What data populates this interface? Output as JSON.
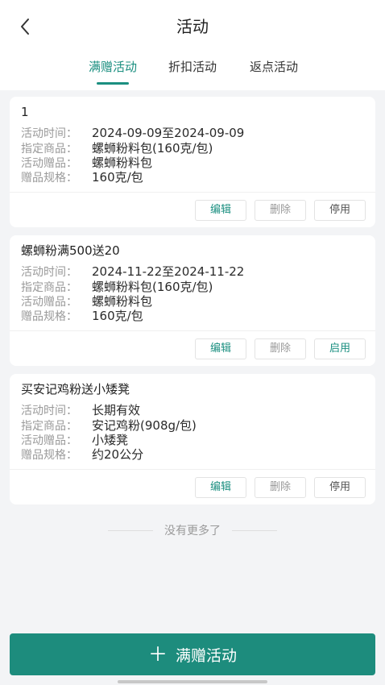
{
  "header": {
    "title": "活动",
    "back_icon": "chevron-left-icon"
  },
  "tabs": [
    {
      "label": "满赠活动",
      "active": true
    },
    {
      "label": "折扣活动",
      "active": false
    },
    {
      "label": "返点活动",
      "active": false
    }
  ],
  "labels": {
    "time": "活动时间：",
    "product": "指定商品：",
    "gift": "活动赠品：",
    "spec": "赠品规格："
  },
  "activities": [
    {
      "title": "1",
      "time": "2024-09-09至2024-09-09",
      "product": "螺蛳粉料包(160克/包)",
      "gift": "螺蛳粉料包",
      "spec": "160克/包",
      "edit": "编辑",
      "delete": "删除",
      "toggle": "停用"
    },
    {
      "title": "螺蛳粉满500送20",
      "time": "2024-11-22至2024-11-22",
      "product": "螺蛳粉料包(160克/包)",
      "gift": "螺蛳粉料包",
      "spec": "160克/包",
      "edit": "编辑",
      "delete": "删除",
      "toggle": "启用"
    },
    {
      "title": "买安记鸡粉送小矮凳",
      "time": "长期有效",
      "product": "安记鸡粉(908g/包)",
      "gift": "小矮凳",
      "spec": "约20公分",
      "edit": "编辑",
      "delete": "删除",
      "toggle": "停用"
    }
  ],
  "footer_note": "没有更多了",
  "bottom_button": {
    "icon": "plus-icon",
    "label": "满赠活动"
  },
  "colors": {
    "accent": "#1b8f80",
    "button": "#1d8c7d",
    "background": "#f3f4f6"
  }
}
